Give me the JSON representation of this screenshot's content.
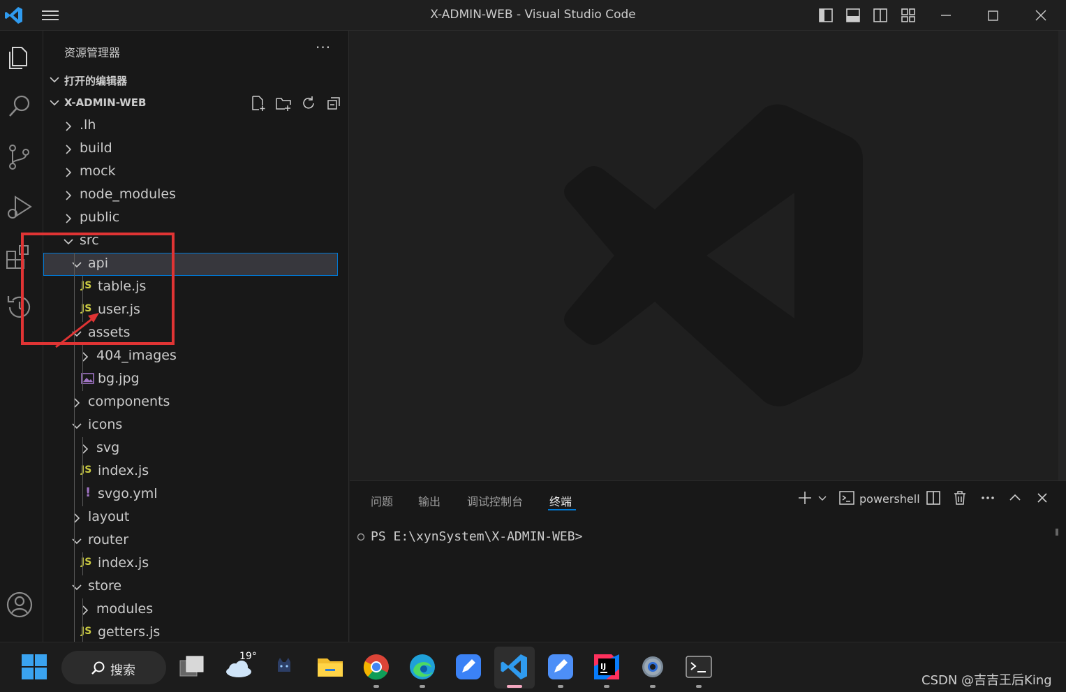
{
  "window": {
    "title": "X-ADMIN-WEB - Visual Studio Code",
    "controls": [
      "layout-sidebar-icon",
      "layout-panel-icon",
      "layout-secondary-icon",
      "customize-layout-icon",
      "minimize-icon",
      "maximize-icon",
      "close-icon"
    ]
  },
  "activity_bar": [
    "explorer-icon",
    "search-icon",
    "source-control-icon",
    "run-debug-icon",
    "extensions-icon",
    "timeline-icon",
    "account-icon"
  ],
  "sidebar": {
    "title": "资源管理器",
    "more": "···",
    "open_editors": "打开的编辑器",
    "project": "X-ADMIN-WEB",
    "tree": [
      {
        "label": ".lh",
        "type": "folder",
        "expanded": false,
        "depth": 0
      },
      {
        "label": "build",
        "type": "folder",
        "expanded": false,
        "depth": 0
      },
      {
        "label": "mock",
        "type": "folder",
        "expanded": false,
        "depth": 0
      },
      {
        "label": "node_modules",
        "type": "folder",
        "expanded": false,
        "depth": 0
      },
      {
        "label": "public",
        "type": "folder",
        "expanded": false,
        "depth": 0
      },
      {
        "label": "src",
        "type": "folder",
        "expanded": true,
        "depth": 0
      },
      {
        "label": "api",
        "type": "folder",
        "expanded": true,
        "depth": 1,
        "selected": true
      },
      {
        "label": "table.js",
        "type": "js",
        "depth": 2
      },
      {
        "label": "user.js",
        "type": "js",
        "depth": 2
      },
      {
        "label": "assets",
        "type": "folder",
        "expanded": true,
        "depth": 1
      },
      {
        "label": "404_images",
        "type": "folder",
        "expanded": false,
        "depth": 2
      },
      {
        "label": "bg.jpg",
        "type": "image",
        "depth": 2
      },
      {
        "label": "components",
        "type": "folder",
        "expanded": false,
        "depth": 1
      },
      {
        "label": "icons",
        "type": "folder",
        "expanded": true,
        "depth": 1
      },
      {
        "label": "svg",
        "type": "folder",
        "expanded": false,
        "depth": 2
      },
      {
        "label": "index.js",
        "type": "js",
        "depth": 2
      },
      {
        "label": "svgo.yml",
        "type": "yml",
        "depth": 2
      },
      {
        "label": "layout",
        "type": "folder",
        "expanded": false,
        "depth": 1
      },
      {
        "label": "router",
        "type": "folder",
        "expanded": true,
        "depth": 1
      },
      {
        "label": "index.js",
        "type": "js",
        "depth": 2
      },
      {
        "label": "store",
        "type": "folder",
        "expanded": true,
        "depth": 1
      },
      {
        "label": "modules",
        "type": "folder",
        "expanded": false,
        "depth": 2
      },
      {
        "label": "getters.js",
        "type": "js",
        "depth": 2
      }
    ],
    "js_badge": "JS",
    "yml_badge": "!"
  },
  "panel": {
    "tabs": [
      {
        "label": "问题",
        "active": false
      },
      {
        "label": "输出",
        "active": false
      },
      {
        "label": "调试控制台",
        "active": false
      },
      {
        "label": "终端",
        "active": true
      }
    ],
    "shell": "powershell",
    "terminal_line": "PS E:\\xynSystem\\X-ADMIN-WEB>"
  },
  "taskbar": {
    "search_label": "搜索",
    "weather_temp": "19°",
    "apps": [
      "windows-start-icon",
      "task-view-icon",
      "weather-icon",
      "cat-app-icon",
      "file-explorer-icon",
      "chrome-icon",
      "edge-icon",
      "note-app-icon",
      "vscode-icon",
      "note-app-2-icon",
      "intellij-icon",
      "settings-icon",
      "terminal-icon"
    ]
  },
  "watermark": "CSDN @吉吉王后King",
  "colors": {
    "accent": "#0078d4",
    "annotation": "#e03434",
    "js_badge": "#cbcb41"
  }
}
